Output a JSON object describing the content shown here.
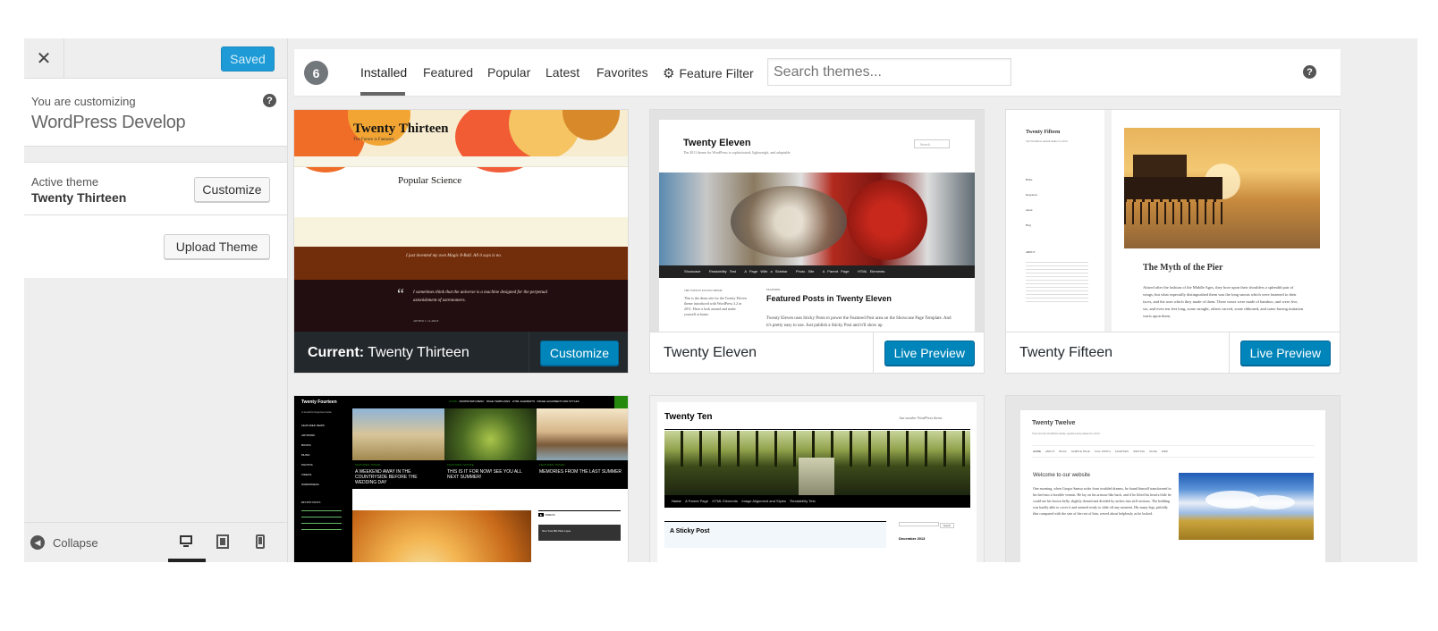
{
  "sidebar": {
    "close_icon": "close-icon",
    "saved_label": "Saved",
    "customizing_label": "You are customizing",
    "site_title": "WordPress Develop",
    "active_theme_label": "Active theme",
    "active_theme_name": "Twenty Thirteen",
    "customize_label": "Customize",
    "upload_label": "Upload Theme",
    "collapse_label": "Collapse",
    "devices": [
      "desktop-icon",
      "tablet-icon",
      "mobile-icon"
    ],
    "active_device": "desktop"
  },
  "filter": {
    "count": "6",
    "tabs": [
      "Installed",
      "Featured",
      "Popular",
      "Latest",
      "Favorites",
      "Feature Filter"
    ],
    "active_tab": "Installed",
    "search_placeholder": "Search themes..."
  },
  "themes": [
    {
      "name": "Twenty Thirteen",
      "current": true,
      "current_prefix": "Current:",
      "action": "Customize",
      "shot": {
        "title": "Twenty Thirteen",
        "tagline": "The Future is Fantastic",
        "post": "Popular Science",
        "quote1": "I just invented my own Magic 8-Ball. All it says is no.",
        "quote2": "I sometimes think that the universe is a machine designed for the perpetual astonishment of astronomers.",
        "quote2_author": "ARTHUR C. CLARKE"
      }
    },
    {
      "name": "Twenty Eleven",
      "current": false,
      "action": "Live Preview",
      "shot": {
        "title": "Twenty Eleven",
        "tagline": "The 2011 theme for WordPress is sophisticated, lightweight, and adaptable",
        "search": "Search",
        "menu": [
          "Showcase",
          "Readability Test",
          "A Page With a Sidebar",
          "Photo Site",
          "A Parent Page",
          "HTML Elements"
        ],
        "section": "THE TWENTY ELEVEN THEME",
        "featured_label": "FEATURED",
        "featured_title": "Featured Posts in Twenty Eleven",
        "featured_text": "Twenty Eleven uses Sticky Posts to power the Featured Post area on the Showcase Page Template. And it's pretty easy to use. Just publish a Sticky Post and it'll show up",
        "intro": "This is the demo site for the Twenty Eleven theme introduced with WordPress 3.2 in 2011. Have a look around and make yourself at home."
      }
    },
    {
      "name": "Twenty Fifteen",
      "current": false,
      "action": "Live Preview",
      "shot": {
        "title": "Twenty Fifteen",
        "tagline": "The WordPress default theme for 2015.",
        "menu": [
          "Home",
          "Dropdown",
          "About",
          "Blog"
        ],
        "about_label": "ABOUT",
        "post": "The Myth of the Pier",
        "post_text": "Attired after the fashion of the Middle Ages, they bore upon their shoulders a splendid pair of wings; but what especially distinguished them was the long snouts which were fastened to their faces, and the uses which they made of them. These noses were made of bamboo, and were five, six, and even ten feet long, some straight, others curved, some ribboned, and some having imitation warts upon them."
      }
    },
    {
      "name": "Twenty Fourteen",
      "current": false,
      "shot": {
        "title": "Twenty Fourteen",
        "tagline": "A beautiful magazine theme",
        "sidebar_menu": [
          "FEATURED NEWS",
          "ARTWORK",
          "BOOKS",
          "MUSIC",
          "PHOTOS",
          "VIDEOS",
          "WORDPRESS"
        ],
        "recent_label": "RECENT POSTS",
        "top_menu": [
          "HOME",
          "DROPDOWN MENU",
          "PAGE TEMPLATES",
          "HTML ELEMENTS",
          "IMAGE ALIGNMENT AND STYLES"
        ],
        "posts": [
          {
            "cat": "FEATURED, TRAVEL",
            "title": "A WEEKEND AWAY IN THE COUNTRYSIDE BEFORE THE WEDDING DAY"
          },
          {
            "cat": "FEATURED, NATURE",
            "title": "THIS IS IT FOR NOW! SEE YOU ALL NEXT SUMMER!"
          },
          {
            "cat": "FEATURED, TRAVEL",
            "title": "MEMORIES FROM THE LAST SUMMER"
          }
        ],
        "videos_label": "VIDEOS",
        "video_title": "New York HD Time Lapse"
      }
    },
    {
      "name": "Twenty Ten",
      "current": false,
      "shot": {
        "title": "Twenty Ten",
        "tagline": "Just another WordPress theme",
        "menu": [
          "Home",
          "A Parent Page",
          "HTML Elements",
          "Image Alignment and Styles",
          "Readability Test"
        ],
        "post": "A Sticky Post",
        "search": "Search",
        "archive": "December 2013"
      }
    },
    {
      "name": "Twenty Twelve",
      "current": false,
      "shot": {
        "title": "Twenty Twelve",
        "tagline": "Your favorite WordPress theme, updated and polished for 2012.",
        "menu": [
          "HOME",
          "ABOUT",
          "BLOG",
          "SAMPLE PAGE",
          "FULL WIDTH",
          "SHORTIES",
          "WRITING",
          "MUSE",
          "WEB"
        ],
        "welcome": "Welcome to our website",
        "text": "One morning, when Gregor Samsa woke from troubled dreams, he found himself transformed in his bed into a horrible vermin. He lay on his armour-like back, and if he lifted his head a little he could see his brown belly, slightly domed and divided by arches into stiff sections. The bedding was hardly able to cover it and seemed ready to slide off any moment. His many legs, pitifully thin compared with the size of the rest of him, waved about helplessly as he looked."
      }
    }
  ]
}
